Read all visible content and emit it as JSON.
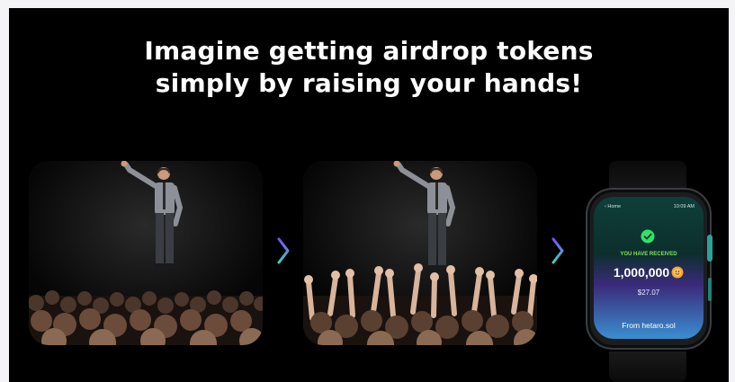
{
  "headline": {
    "line1": "Imagine getting airdrop tokens",
    "line2": "simply by raising your hands!"
  },
  "watch": {
    "back_label": "‹ Home",
    "time": "10:09 AM",
    "received_label": "YOU HAVE RECEIVED",
    "amount": "1,000,000",
    "usd_value": "$27.07",
    "from_label": "From hetaro.sol"
  },
  "icons": {
    "arrow": "chevron-right-icon",
    "check": "check-circle-icon",
    "token": "token-coin-icon"
  },
  "colors": {
    "background": "#000000",
    "chevron_gradient": [
      "#7a4dff",
      "#3fd0c0"
    ],
    "received_green": "#7fe35a",
    "check_green": "#2ee36c"
  }
}
